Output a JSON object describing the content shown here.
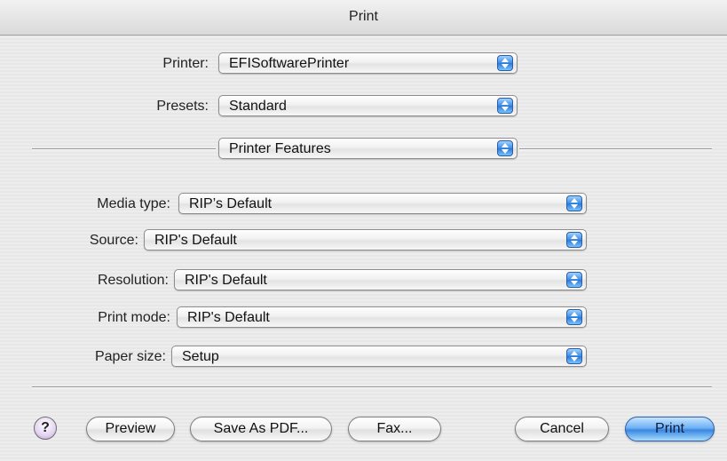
{
  "window": {
    "title": "Print"
  },
  "printer": {
    "label": "Printer:",
    "value": "EFISoftwarePrinter"
  },
  "presets": {
    "label": "Presets:",
    "value": "Standard"
  },
  "section": {
    "value": "Printer Features"
  },
  "features": [
    {
      "label": "Media type:",
      "value": "RIP’s Default"
    },
    {
      "label": "Source:",
      "value": "RIP's Default"
    },
    {
      "label": "Resolution:",
      "value": "RIP's Default"
    },
    {
      "label": "Print mode:",
      "value": "RIP's Default"
    },
    {
      "label": "Paper size:",
      "value": "Setup"
    }
  ],
  "buttons": {
    "help": "?",
    "preview": "Preview",
    "save_pdf": "Save As PDF...",
    "fax": "Fax...",
    "cancel": "Cancel",
    "print": "Print"
  },
  "colors": {
    "accent": "#3a87e0",
    "background": "#ececec"
  }
}
